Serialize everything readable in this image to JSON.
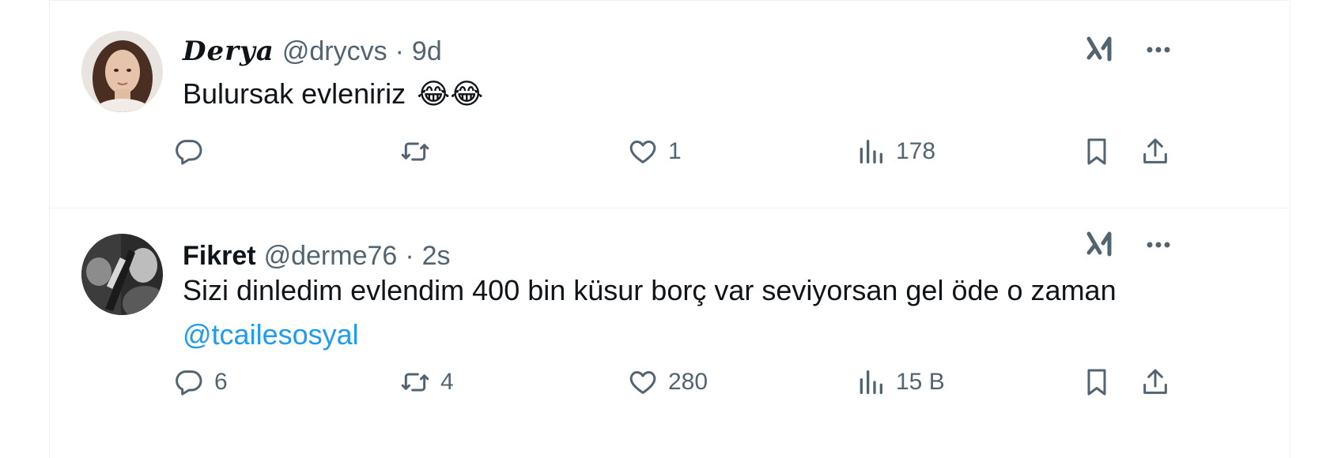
{
  "tweets": [
    {
      "name": "Derya",
      "handle": "@drycvs",
      "separator": "·",
      "time": "9d",
      "text": "Bulursak evleniriz",
      "emoji": "😂😂",
      "mention": "",
      "replies": "",
      "retweets": "",
      "likes": "1",
      "views": "178"
    },
    {
      "name": "Fikret",
      "handle": "@derme76",
      "separator": "·",
      "time": "2s",
      "text": "Sizi dinledim evlendim 400 bin küsur borç var seviyorsan gel öde o zaman",
      "emoji": "",
      "mention": "@tcailesosyal",
      "replies": "6",
      "retweets": "4",
      "likes": "280",
      "views": "15 B"
    }
  ],
  "icons": {
    "reply": "reply-icon",
    "retweet": "retweet-icon",
    "like": "like-icon",
    "views": "views-icon",
    "bookmark": "bookmark-icon",
    "share": "share-icon",
    "grok": "grok-icon",
    "more": "more-icon"
  },
  "colors": {
    "text": "#0f1419",
    "secondary": "#536471",
    "link": "#1d9bf0",
    "border": "#eff3f4"
  }
}
